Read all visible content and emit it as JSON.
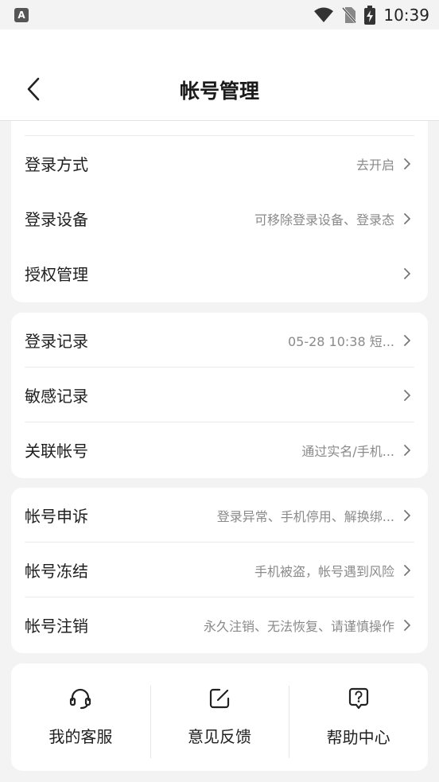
{
  "status_bar": {
    "app_badge": "A",
    "time": "10:39"
  },
  "header": {
    "title": "帐号管理"
  },
  "sections": [
    {
      "rows": [
        {
          "label": "登录方式",
          "value": "去开启"
        },
        {
          "label": "登录设备",
          "value": "可移除登录设备、登录态"
        },
        {
          "label": "授权管理",
          "value": ""
        }
      ]
    },
    {
      "rows": [
        {
          "label": "登录记录",
          "value": "05-28 10:38 短..."
        },
        {
          "label": "敏感记录",
          "value": ""
        },
        {
          "label": "关联帐号",
          "value": "通过实名/手机..."
        }
      ]
    },
    {
      "rows": [
        {
          "label": "帐号申诉",
          "value": "登录异常、手机停用、解换绑..."
        },
        {
          "label": "帐号冻结",
          "value": "手机被盗，帐号遇到风险"
        },
        {
          "label": "帐号注销",
          "value": "永久注销、无法恢复、请谨慎操作"
        }
      ]
    }
  ],
  "quick_actions": [
    {
      "label": "我的客服",
      "icon": "headset-icon"
    },
    {
      "label": "意见反馈",
      "icon": "edit-icon"
    },
    {
      "label": "帮助中心",
      "icon": "help-icon"
    }
  ]
}
